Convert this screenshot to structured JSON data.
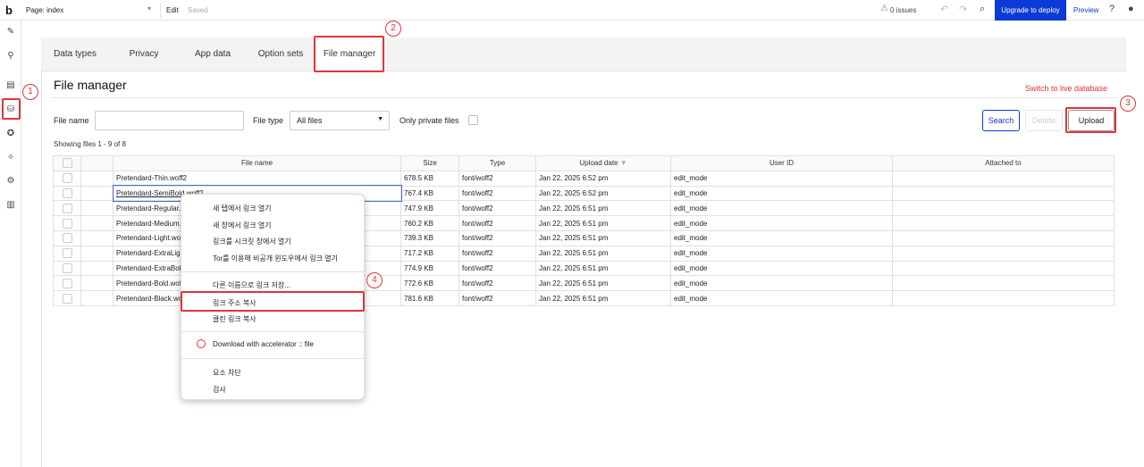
{
  "topbar": {
    "logo": "b",
    "page_select": "Page: index",
    "edit": "Edit",
    "saved": "Saved",
    "issues": "0 issues",
    "upgrade": "Upgrade to deploy",
    "preview": "Preview"
  },
  "annotations": [
    "1",
    "2",
    "3",
    "4"
  ],
  "tabs": [
    "Data types",
    "Privacy",
    "App data",
    "Option sets",
    "File manager"
  ],
  "section": {
    "title": "File manager",
    "switch_live": "Switch to live database"
  },
  "filters": {
    "file_name_label": "File name",
    "file_type_label": "File type",
    "file_type_value": "All files",
    "only_private_label": "Only private files"
  },
  "buttons": {
    "search": "Search",
    "delete": "Delete",
    "upload": "Upload"
  },
  "showing": "Showing files 1 - 9 of 8",
  "table": {
    "columns": [
      "File name",
      "Size",
      "Type",
      "Upload date",
      "User ID",
      "Attached to"
    ],
    "rows": [
      {
        "name": "Pretendard-Thin.woff2",
        "size": "678.5 KB",
        "type": "font/woff2",
        "date": "Jan 22, 2025 6:52 pm",
        "user": "edit_mode"
      },
      {
        "name": "Pretendard-SemiBold.woff2",
        "size": "767.4 KB",
        "type": "font/woff2",
        "date": "Jan 22, 2025 6:52 pm",
        "user": "edit_mode"
      },
      {
        "name": "Pretendard-Regular.woff2",
        "size": "747.9 KB",
        "type": "font/woff2",
        "date": "Jan 22, 2025 6:51 pm",
        "user": "edit_mode"
      },
      {
        "name": "Pretendard-Medium.woff2",
        "size": "760.2 KB",
        "type": "font/woff2",
        "date": "Jan 22, 2025 6:51 pm",
        "user": "edit_mode"
      },
      {
        "name": "Pretendard-Light.woff2",
        "size": "739.3 KB",
        "type": "font/woff2",
        "date": "Jan 22, 2025 6:51 pm",
        "user": "edit_mode"
      },
      {
        "name": "Pretendard-ExtraLight.woff2",
        "size": "717.2 KB",
        "type": "font/woff2",
        "date": "Jan 22, 2025 6:51 pm",
        "user": "edit_mode"
      },
      {
        "name": "Pretendard-ExtraBold.woff2",
        "size": "774.9 KB",
        "type": "font/woff2",
        "date": "Jan 22, 2025 6:51 pm",
        "user": "edit_mode"
      },
      {
        "name": "Pretendard-Bold.woff2",
        "size": "772.6 KB",
        "type": "font/woff2",
        "date": "Jan 22, 2025 6:51 pm",
        "user": "edit_mode"
      },
      {
        "name": "Pretendard-Black.woff2",
        "size": "781.6 KB",
        "type": "font/woff2",
        "date": "Jan 22, 2025 6:51 pm",
        "user": "edit_mode"
      }
    ]
  },
  "context_menu": {
    "items": [
      "새 탭에서 링크 열기",
      "새 창에서 링크 열기",
      "링크를 시크릿 창에서 열기",
      "Tor를 이용해 비공개 윈도우에서 링크 열기",
      "다른 이름으로 링크 저장...",
      "링크 주소 복사",
      "클린 링크 복사",
      "Download with accelerator :: file",
      "요소 차단",
      "검사"
    ]
  },
  "colors": {
    "accent": "#0b3ad6",
    "annotation_red": "#e0343b"
  }
}
